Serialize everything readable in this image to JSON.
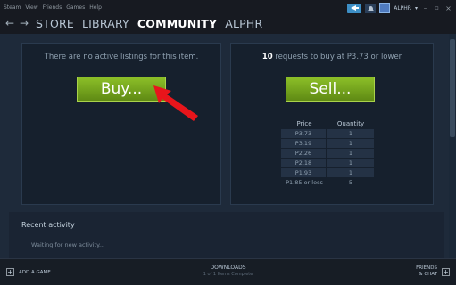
{
  "menubar": {
    "items": [
      "Steam",
      "View",
      "Friends",
      "Games",
      "Help"
    ],
    "account_name": "ALPHR"
  },
  "nav": {
    "store": "STORE",
    "library": "LIBRARY",
    "community": "COMMUNITY",
    "profile": "ALPHR"
  },
  "buy_panel": {
    "message": "There are no active listings for this item.",
    "button_label": "Buy..."
  },
  "sell_panel": {
    "requests_count": "10",
    "requests_text": " requests to buy at P3.73 or lower",
    "button_label": "Sell...",
    "table": {
      "headers": [
        "Price",
        "Quantity"
      ],
      "rows": [
        {
          "price": "P3.73",
          "qty": "1"
        },
        {
          "price": "P3.19",
          "qty": "1"
        },
        {
          "price": "P2.26",
          "qty": "1"
        },
        {
          "price": "P2.18",
          "qty": "1"
        },
        {
          "price": "P1.93",
          "qty": "1"
        },
        {
          "price": "P1.85 or less",
          "qty": "5"
        }
      ]
    }
  },
  "recent": {
    "title": "Recent activity",
    "waiting": "Waiting for new activity..."
  },
  "bottom": {
    "add_game": "ADD A GAME",
    "downloads": "DOWNLOADS",
    "downloads_status": "1 of 1 Items Complete",
    "friends_line1": "FRIENDS",
    "friends_line2": "& CHAT"
  },
  "icons": {
    "back": "back-arrow-icon",
    "forward": "forward-arrow-icon",
    "broadcast": "broadcast-icon",
    "notifications": "bell-icon",
    "add": "plus-icon",
    "friends": "friends-plus-icon",
    "annotation": "red-arrow-annotation"
  },
  "colors": {
    "accent_green": "#8cbf28",
    "background": "#1b2838",
    "annotation_red": "#e8151b"
  }
}
